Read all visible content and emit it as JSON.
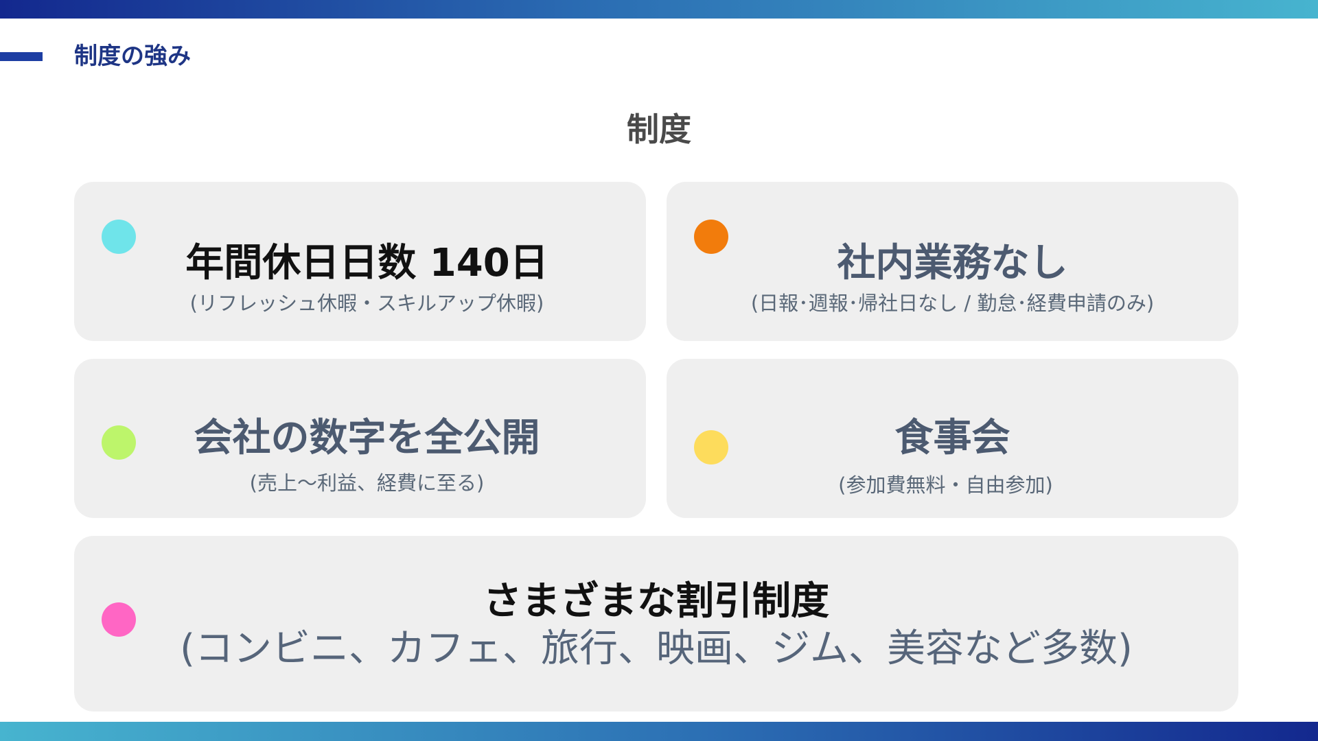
{
  "header": {
    "section_title": "制度の強み"
  },
  "main": {
    "heading": "制度"
  },
  "cards": [
    {
      "title": "年間休日日数 140日",
      "subtitle": "(リフレッシュ休暇・スキルアップ休暇)",
      "dot_color": "#6fe4ea"
    },
    {
      "title": "社内業務なし",
      "subtitle": "(日報･週報･帰社日なし / 勤怠･経費申請のみ)",
      "dot_color": "#f27c0c"
    },
    {
      "title": "会社の数字を全公開",
      "subtitle": "(売上〜利益、経費に至る)",
      "dot_color": "#bdf56b"
    },
    {
      "title": "食事会",
      "subtitle": "(参加費無料・自由参加)",
      "dot_color": "#fddc5c"
    },
    {
      "title": "さまざまな割引制度",
      "subtitle": "(コンビニ、カフェ、旅行、映画、ジム、美容など多数)",
      "dot_color": "#ff66c4"
    }
  ],
  "colors": {
    "accent_dark_blue": "#13288e",
    "accent_light_blue": "#47b4cf",
    "card_background": "#efefef"
  }
}
